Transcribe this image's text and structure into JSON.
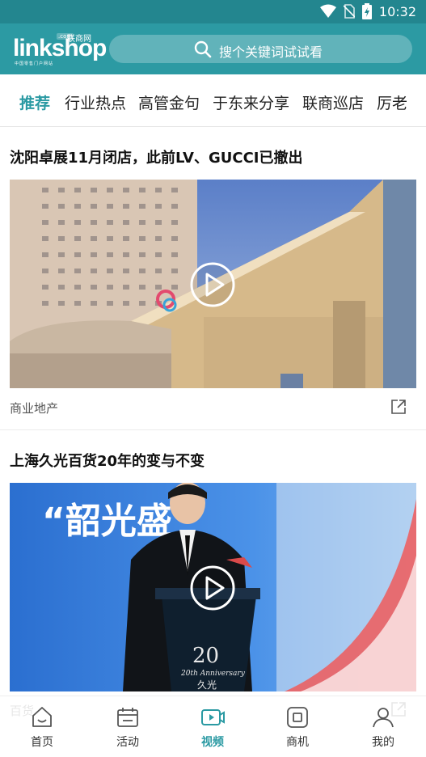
{
  "status_bar": {
    "time": "10:32",
    "icons": [
      "wifi-icon",
      "no-sim-icon",
      "battery-charging-icon"
    ]
  },
  "header": {
    "logo_text": "linkshop",
    "logo_cn": "联商网",
    "logo_com": ".com",
    "logo_sub": "中国零售门户网站",
    "search_placeholder": "搜个关键词试试看"
  },
  "tabs": [
    {
      "label": "推荐",
      "active": true
    },
    {
      "label": "行业热点"
    },
    {
      "label": "高管金句"
    },
    {
      "label": "于东来分享"
    },
    {
      "label": "联商巡店"
    },
    {
      "label": "厉老"
    }
  ],
  "feed": [
    {
      "title": "沈阳卓展11月闭店，此前LV、GUCCI已撤出",
      "category": "商业地产"
    },
    {
      "title": "上海久光百货20年的变与不变",
      "category": "百货"
    }
  ],
  "image_text": {
    "banner_quote": "“韶光盛",
    "anniversary": "20th Anniversary",
    "brand_cn": "久光"
  },
  "bottom_nav": [
    {
      "label": "首页",
      "icon": "home-icon"
    },
    {
      "label": "活动",
      "icon": "calendar-icon"
    },
    {
      "label": "视频",
      "icon": "video-icon",
      "active": true
    },
    {
      "label": "商机",
      "icon": "opportunity-icon"
    },
    {
      "label": "我的",
      "icon": "profile-icon"
    }
  ],
  "colors": {
    "brand": "#2c9aa3",
    "status_bar": "#23868f",
    "active_tab": "#2b9aa3"
  }
}
